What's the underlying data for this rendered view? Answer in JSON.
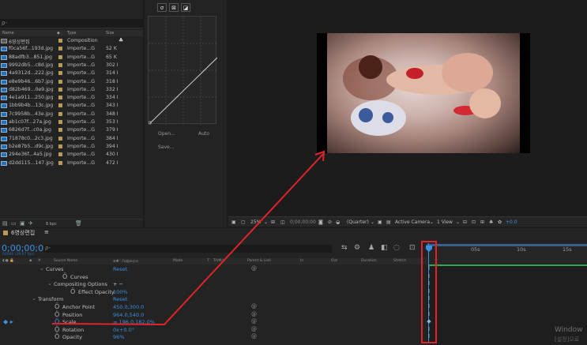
{
  "project": {
    "search_glyph": "ρ-",
    "headers": {
      "name": "Name",
      "type": "Type",
      "size": "Size"
    },
    "items": [
      {
        "name": "6영상편집",
        "type": "Composition",
        "size": "",
        "kind": "comp"
      },
      {
        "name": "f0ca56f...193d.jpg",
        "type": "Importe...G",
        "size": "52 K",
        "kind": "image"
      },
      {
        "name": "88adfb3...851.jpg",
        "type": "Importe...G",
        "size": "65 K",
        "kind": "image"
      },
      {
        "name": "9992db5...c8d.jpg",
        "type": "Importe...G",
        "size": "302 I",
        "kind": "image"
      },
      {
        "name": "4a9312d...222.jpg",
        "type": "Importe...G",
        "size": "314 I",
        "kind": "image"
      },
      {
        "name": "e8e9b46...6b7.jpg",
        "type": "Importe...G",
        "size": "318 I",
        "kind": "image"
      },
      {
        "name": "d82b469...0e9.jpg",
        "type": "Importe...G",
        "size": "332 I",
        "kind": "image"
      },
      {
        "name": "4e1a911...250.jpg",
        "type": "Importe...G",
        "size": "334 I",
        "kind": "image"
      },
      {
        "name": "1bb9b4b...13c.jpg",
        "type": "Importe...G",
        "size": "343 I",
        "kind": "image"
      },
      {
        "name": "7c9958b...43e.jpg",
        "type": "Importe...G",
        "size": "348 I",
        "kind": "image"
      },
      {
        "name": "ab1c07f...27a.jpg",
        "type": "Importe...G",
        "size": "353 I",
        "kind": "image"
      },
      {
        "name": "6826d7f...c0a.jpg",
        "type": "Importe...G",
        "size": "379 I",
        "kind": "image"
      },
      {
        "name": "71878c0...2c3.jpg",
        "type": "Importe...G",
        "size": "384 I",
        "kind": "image"
      },
      {
        "name": "b2e87b5...d9c.jpg",
        "type": "Importe...G",
        "size": "394 I",
        "kind": "image"
      },
      {
        "name": "294e36f...4a5.jpg",
        "type": "Importe...G",
        "size": "430 I",
        "kind": "image"
      },
      {
        "name": "d2dd115...147.jpg",
        "type": "Importe...G",
        "size": "472 I",
        "kind": "image"
      }
    ],
    "bpc": "8 bpc"
  },
  "effects": {
    "open_label": "Open...",
    "auto_label": "Auto",
    "save_label": "Save..."
  },
  "viewer": {
    "zoom": "25%",
    "timecode": "0;00;00;00",
    "resolution": "(Quarter)",
    "camera": "Active Camera",
    "views": "1 View",
    "exposure": "+0.0"
  },
  "timeline": {
    "tab_label": "6영상편집",
    "timecode": "0;00;00;00",
    "fps": "00000 (29.97 fps)",
    "search_glyph": "ρ-",
    "columns": {
      "source": "Source Name",
      "mode": "Mode",
      "t": "T",
      "trkmat": "TrkMat",
      "parent": "Parent & Link",
      "in": "In",
      "out": "Out",
      "duration": "Duration",
      "stretch": "Stretch"
    },
    "ruler": [
      "05s",
      "10s",
      "15s"
    ],
    "properties": [
      {
        "name": "Curves",
        "value": "Reset",
        "indent": 1,
        "twirl": "⌄",
        "pick": "@"
      },
      {
        "name": "Curves",
        "value": "",
        "indent": 2,
        "stopwatch": true
      },
      {
        "name": "Compositing Options",
        "value": "+ −",
        "indent": 2,
        "twirl": "⌄"
      },
      {
        "name": "Effect Opacity",
        "value": "100%",
        "indent": 3,
        "stopwatch": true
      },
      {
        "name": "Transform",
        "value": "Reset",
        "indent": 0,
        "twirl": "⌄"
      },
      {
        "name": "Anchor Point",
        "value": "450.0,300.0",
        "indent": 1,
        "stopwatch": true,
        "pick": "@"
      },
      {
        "name": "Position",
        "value": "964.0,540.0",
        "indent": 1,
        "stopwatch": true,
        "pick": "@"
      },
      {
        "name": "Scale",
        "value": "∞ 196.0,182.0%",
        "indent": 1,
        "stopwatch": true,
        "active": true,
        "pick": "@"
      },
      {
        "name": "Rotation",
        "value": "0x+0.0°",
        "indent": 1,
        "stopwatch": true,
        "pick": "@"
      },
      {
        "name": "Opacity",
        "value": "96%",
        "indent": 1,
        "stopwatch": true,
        "pick": "@"
      }
    ]
  },
  "watermark": {
    "line1": "Window",
    "line2": "[설정]으로"
  },
  "colors": {
    "accent": "#3d8fe0",
    "annotation": "#e0242a",
    "label_gold": "#b89b56"
  }
}
